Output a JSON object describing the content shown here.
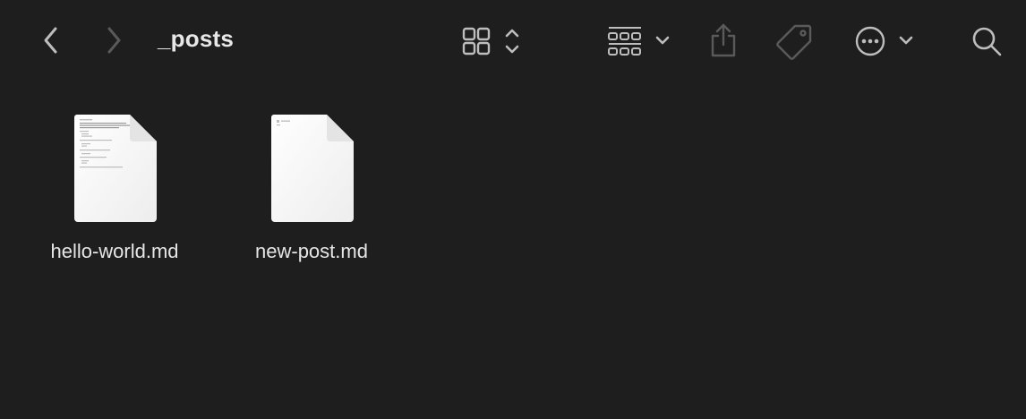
{
  "window": {
    "title": "_posts"
  },
  "toolbar": {
    "back_icon": "chevron-left-icon",
    "forward_icon": "chevron-right-icon",
    "view_icon": "icon-grid-view-icon",
    "group_icon": "group-by-icon",
    "share_icon": "share-icon",
    "tag_icon": "tag-icon",
    "more_icon": "ellipsis-circle-icon",
    "search_icon": "search-icon"
  },
  "files": [
    {
      "name": "hello-world.md",
      "icon": "markdown-document-icon"
    },
    {
      "name": "new-post.md",
      "icon": "markdown-document-icon"
    }
  ],
  "colors": {
    "background": "#1e1e1e",
    "icon": "#bdbdbd",
    "icon_disabled": "#5a5a5a",
    "text": "#e6e6e6"
  }
}
